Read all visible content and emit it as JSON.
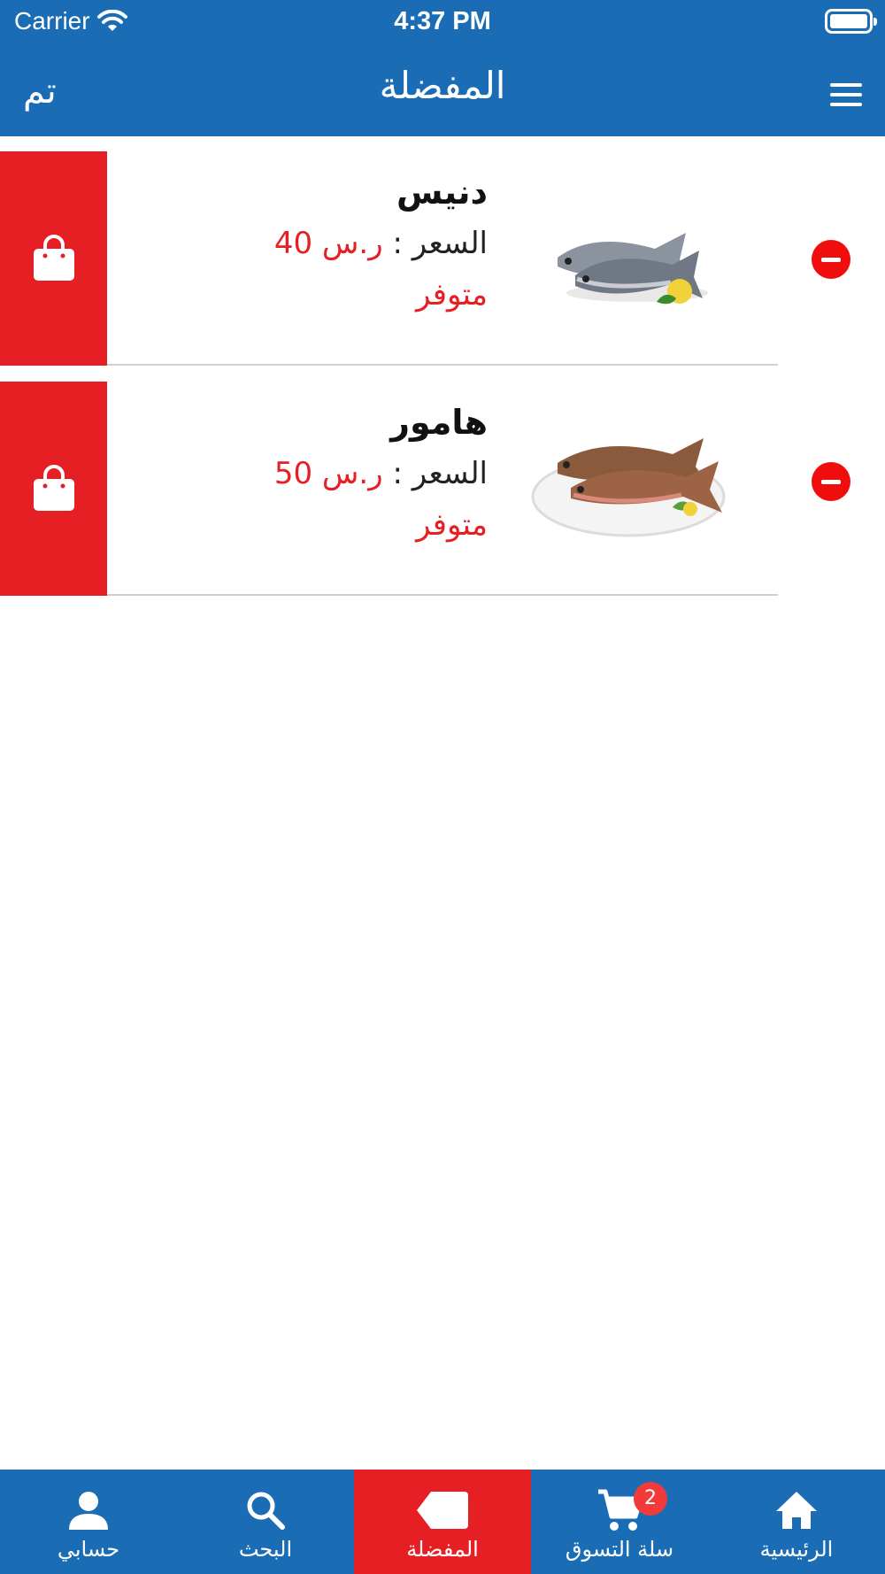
{
  "status_bar": {
    "carrier": "Carrier",
    "time": "4:37 PM"
  },
  "nav": {
    "done_label": "تم",
    "title": "المفضلة"
  },
  "items": [
    {
      "name": "دنيس",
      "price_label": "السعر :",
      "price_value": "ر.س 40",
      "status": "متوفر",
      "image": "two-sea-bream-fish"
    },
    {
      "name": "هامور",
      "price_label": "السعر :",
      "price_value": "ر.س 50",
      "status": "متوفر",
      "image": "grouper-fish-on-plate"
    }
  ],
  "tabs": [
    {
      "label": "حسابي",
      "icon": "person-icon"
    },
    {
      "label": "البحث",
      "icon": "search-icon"
    },
    {
      "label": "المفضلة",
      "icon": "tag-icon",
      "active": true
    },
    {
      "label": "سلة التسوق",
      "icon": "cart-icon",
      "badge": "2"
    },
    {
      "label": "الرئيسية",
      "icon": "home-icon"
    }
  ],
  "colors": {
    "primary": "#1a6db5",
    "accent": "#e61f24"
  }
}
